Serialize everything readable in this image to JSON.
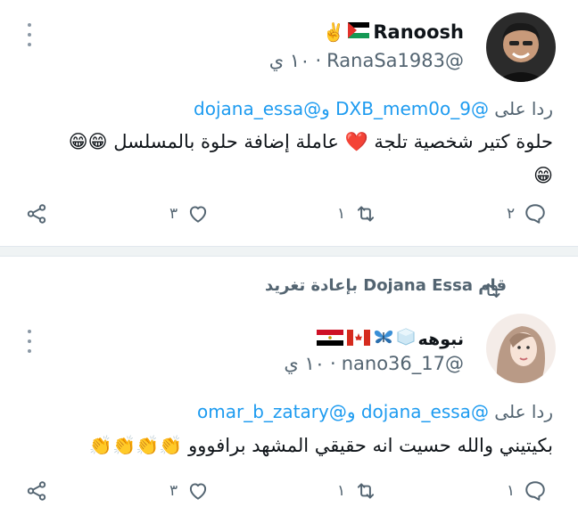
{
  "tweets": [
    {
      "display_name": "Ranoosh",
      "handle": "@RanaSa1983",
      "time": "١٠ ي",
      "reply_prefix": "ردا على",
      "reply_mention_1": "@DXB_mem0o_9",
      "reply_joiner": "و",
      "reply_mention_2": "@dojana_essa",
      "text": "حلوة كتير شخصية تلجة ❤️ عاملة إضافة حلوة بالمسلسل 😁😁",
      "text_line2": "😁",
      "replies": "٢",
      "retweets": "١",
      "likes": "٣"
    },
    {
      "retweeted_by": "قام Dojana Essa بإعادة تغريد",
      "display_name": "نبوهه",
      "handle": "@nano36_17",
      "time": "١٠ ي",
      "reply_prefix": "ردا على",
      "reply_mention_1": "@dojana_essa",
      "reply_joiner": "و",
      "reply_mention_2": "@omar_b_zatary",
      "text": "بكيتيني والله حسيت انه حقيقي المشهد برافووو 👏👏👏👏",
      "replies": "١",
      "retweets": "١",
      "likes": "٣"
    }
  ],
  "icons": {
    "reply": "reply-icon",
    "retweet": "retweet-icon",
    "like": "heart-icon",
    "share": "share-icon",
    "more": "more-dots-icon"
  },
  "colors": {
    "accent": "#1d9bf0",
    "muted": "#536471",
    "heart": "#e0245e"
  }
}
